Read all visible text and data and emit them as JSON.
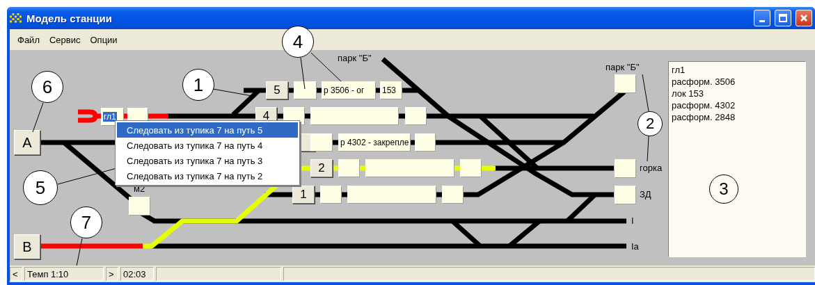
{
  "window": {
    "title": "Модель станции"
  },
  "menu": [
    {
      "label": "Файл"
    },
    {
      "label": "Сервис"
    },
    {
      "label": "Опции"
    }
  ],
  "station": {
    "entries": [
      {
        "label": "А"
      },
      {
        "label": "В"
      }
    ],
    "dead_end": {
      "label": "гл1",
      "selected": true
    },
    "tracks": [
      {
        "number": "5",
        "train": "р 3506 - ог",
        "loco": "153"
      },
      {
        "number": "4"
      },
      {
        "train": "р 4302 - закрепле"
      },
      {
        "number": "2"
      },
      {
        "number": "1"
      }
    ],
    "shunting_box": {
      "label": "м2"
    },
    "park_labels": [
      {
        "label": "парк \"Б\""
      },
      {
        "label": "парк \"Б\""
      }
    ],
    "exit_labels": [
      {
        "label": "горка"
      },
      {
        "label": "ЗД"
      }
    ],
    "line_labels": [
      {
        "label": "I"
      },
      {
        "label": "Ia"
      }
    ]
  },
  "context_menu": [
    {
      "label": "Следовать из тупика 7 на путь 5",
      "selected": true
    },
    {
      "label": "Следовать из тупика 7 на путь 4",
      "selected": false
    },
    {
      "label": "Следовать из тупика 7 на путь 3",
      "selected": false
    },
    {
      "label": "Следовать из тупика 7 на путь 2",
      "selected": false
    }
  ],
  "log": [
    "гл1",
    "расформ. 3506",
    "лок 153",
    "расформ. 4302",
    "расформ. 2848"
  ],
  "callouts": [
    "1",
    "2",
    "3",
    "4",
    "5",
    "6",
    "7"
  ],
  "status_bar": {
    "prev": "<",
    "speed": "Темп 1:10",
    "next": ">",
    "time": "02:03"
  }
}
